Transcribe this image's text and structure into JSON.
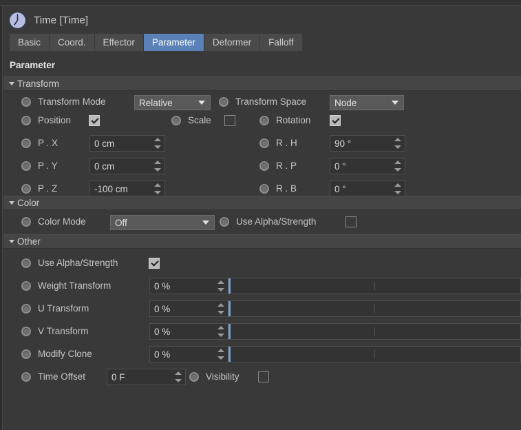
{
  "window": {
    "object_title": "Time [Time]",
    "object_icon": "clock-icon"
  },
  "tabs": [
    {
      "label": "Basic",
      "active": false
    },
    {
      "label": "Coord.",
      "active": false
    },
    {
      "label": "Effector",
      "active": false
    },
    {
      "label": "Parameter",
      "active": true
    },
    {
      "label": "Deformer",
      "active": false
    },
    {
      "label": "Falloff",
      "active": false
    }
  ],
  "page_title": "Parameter",
  "sections": {
    "transform": {
      "header": "Transform",
      "transform_mode_label": "Transform Mode",
      "transform_mode_value": "Relative",
      "transform_space_label": "Transform Space",
      "transform_space_value": "Node",
      "position_label": "Position",
      "position_checked": true,
      "scale_label": "Scale",
      "scale_checked": false,
      "rotation_label": "Rotation",
      "rotation_checked": true,
      "position_fields": [
        {
          "label": "P . X",
          "value": "0 cm"
        },
        {
          "label": "P . Y",
          "value": "0 cm"
        },
        {
          "label": "P . Z",
          "value": "-100 cm"
        }
      ],
      "rotation_fields": [
        {
          "label": "R . H",
          "value": "90 °"
        },
        {
          "label": "R . P",
          "value": "0 °"
        },
        {
          "label": "R . B",
          "value": "0 °"
        }
      ]
    },
    "color": {
      "header": "Color",
      "color_mode_label": "Color Mode",
      "color_mode_value": "Off",
      "use_alpha_label": "Use Alpha/Strength",
      "use_alpha_checked": false
    },
    "other": {
      "header": "Other",
      "use_alpha_label": "Use Alpha/Strength",
      "use_alpha_checked": true,
      "sliders": [
        {
          "label": "Weight Transform",
          "value": "0 %",
          "percent": 0
        },
        {
          "label": "U Transform",
          "value": "0 %",
          "percent": 0
        },
        {
          "label": "V Transform",
          "value": "0 %",
          "percent": 0
        },
        {
          "label": "Modify Clone",
          "value": "0 %",
          "percent": 0
        }
      ],
      "time_offset_label": "Time Offset",
      "time_offset_value": "0 F",
      "visibility_label": "Visibility",
      "visibility_checked": false
    }
  },
  "colors": {
    "panel_bg": "#393939",
    "header_bar": "#454545",
    "tab_bg": "#4a4a4a",
    "tab_active": "#5b82b8",
    "field_bg": "#333333",
    "dropdown_bg": "#595959",
    "slider_accent": "#7ba2d0",
    "icon_fill": "#b7bde2",
    "text": "#c6c6c6"
  }
}
